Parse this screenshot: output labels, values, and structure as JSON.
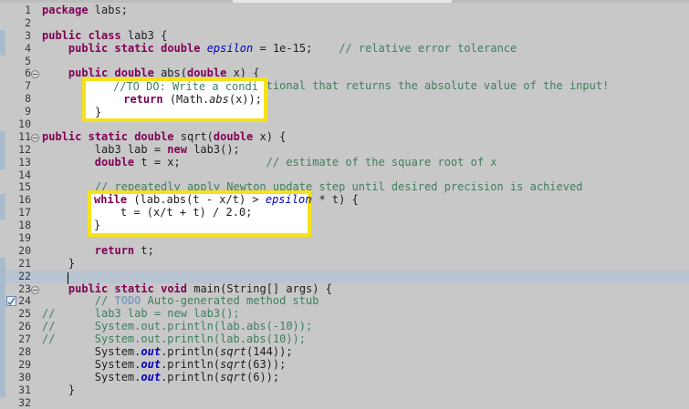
{
  "editor": {
    "lines": [
      {
        "n": "1",
        "segs": [
          {
            "t": "package",
            "c": "kw"
          },
          {
            "t": " labs;"
          }
        ]
      },
      {
        "n": "2",
        "segs": []
      },
      {
        "n": "3",
        "segs": [
          {
            "t": "public",
            "c": "kw"
          },
          {
            "t": " "
          },
          {
            "t": "class",
            "c": "kw"
          },
          {
            "t": " lab3 {"
          }
        ]
      },
      {
        "n": "4",
        "segs": [
          {
            "t": "    "
          },
          {
            "t": "public",
            "c": "kw"
          },
          {
            "t": " "
          },
          {
            "t": "static",
            "c": "kw"
          },
          {
            "t": " "
          },
          {
            "t": "double",
            "c": "kw"
          },
          {
            "t": " "
          },
          {
            "t": "epsilon",
            "c": "fld"
          },
          {
            "t": " = 1e-15;    "
          },
          {
            "t": "// relative error tolerance",
            "c": "cm"
          }
        ]
      },
      {
        "n": "5",
        "segs": []
      },
      {
        "n": "6",
        "fold": true,
        "segs": [
          {
            "t": "    "
          },
          {
            "t": "public",
            "c": "kw"
          },
          {
            "t": " "
          },
          {
            "t": "double",
            "c": "kw"
          },
          {
            "t": " abs("
          },
          {
            "t": "double",
            "c": "kw"
          },
          {
            "t": " x) {"
          }
        ]
      },
      {
        "n": "7",
        "segs": [
          {
            "t": "            "
          },
          {
            "t": "//TO DO: Write a conditional that returns the absolute value of the input!",
            "c": "cm"
          }
        ]
      },
      {
        "n": "8",
        "segs": [
          {
            "t": "            "
          },
          {
            "t": "return",
            "c": "kw"
          },
          {
            "t": " (Math."
          },
          {
            "t": "abs",
            "c": "smeth"
          },
          {
            "t": "(x));"
          }
        ]
      },
      {
        "n": "9",
        "segs": [
          {
            "t": "        }"
          }
        ]
      },
      {
        "n": "10",
        "segs": []
      },
      {
        "n": "11",
        "fold": true,
        "segs": [
          {
            "t": "public",
            "c": "kw"
          },
          {
            "t": " "
          },
          {
            "t": "static",
            "c": "kw"
          },
          {
            "t": " "
          },
          {
            "t": "double",
            "c": "kw"
          },
          {
            "t": " sqrt("
          },
          {
            "t": "double",
            "c": "kw"
          },
          {
            "t": " x) {"
          }
        ]
      },
      {
        "n": "12",
        "segs": [
          {
            "t": "        lab3 lab = "
          },
          {
            "t": "new",
            "c": "kw"
          },
          {
            "t": " lab3();"
          }
        ]
      },
      {
        "n": "13",
        "segs": [
          {
            "t": "        "
          },
          {
            "t": "double",
            "c": "kw"
          },
          {
            "t": " t = x;             "
          },
          {
            "t": "// estimate of the square root of x",
            "c": "cm"
          }
        ]
      },
      {
        "n": "14",
        "segs": []
      },
      {
        "n": "15",
        "segs": [
          {
            "t": "        "
          },
          {
            "t": "// repeatedly apply Newton update step until desired precision is achieved",
            "c": "cm"
          }
        ]
      },
      {
        "n": "16",
        "segs": [
          {
            "t": "        "
          },
          {
            "t": "while",
            "c": "kw"
          },
          {
            "t": " (lab.abs(t - x/t) > "
          },
          {
            "t": "epsilon",
            "c": "fld"
          },
          {
            "t": " * t) {"
          }
        ]
      },
      {
        "n": "17",
        "segs": [
          {
            "t": "            t = (x/t + t) / 2.0;"
          }
        ]
      },
      {
        "n": "18",
        "segs": [
          {
            "t": "        }"
          }
        ]
      },
      {
        "n": "19",
        "segs": []
      },
      {
        "n": "20",
        "segs": [
          {
            "t": "        "
          },
          {
            "t": "return",
            "c": "kw"
          },
          {
            "t": " t;"
          }
        ]
      },
      {
        "n": "21",
        "segs": [
          {
            "t": "    }"
          }
        ]
      },
      {
        "n": "22",
        "current": true,
        "segs": []
      },
      {
        "n": "23",
        "fold": true,
        "segs": [
          {
            "t": "    "
          },
          {
            "t": "public",
            "c": "kw"
          },
          {
            "t": " "
          },
          {
            "t": "static",
            "c": "kw"
          },
          {
            "t": " "
          },
          {
            "t": "void",
            "c": "kw"
          },
          {
            "t": " main(String[] args) {"
          }
        ]
      },
      {
        "n": "24",
        "warn": true,
        "segs": [
          {
            "t": "        "
          },
          {
            "t": "// ",
            "c": "cm"
          },
          {
            "t": "TODO",
            "c": "todo"
          },
          {
            "t": " Auto-generated method stub",
            "c": "cm"
          }
        ]
      },
      {
        "n": "25",
        "segs": [
          {
            "t": "//",
            "c": "cm"
          },
          {
            "t": "      lab3 lab = new lab3();",
            "c": "cm"
          }
        ]
      },
      {
        "n": "26",
        "segs": [
          {
            "t": "//",
            "c": "cm"
          },
          {
            "t": "      System.out.println(lab.abs(-10));",
            "c": "cm"
          }
        ]
      },
      {
        "n": "27",
        "segs": [
          {
            "t": "//",
            "c": "cm"
          },
          {
            "t": "      System.out.println(lab.abs(10));",
            "c": "cm"
          }
        ]
      },
      {
        "n": "28",
        "segs": [
          {
            "t": "        System."
          },
          {
            "t": "out",
            "c": "sfld"
          },
          {
            "t": ".println("
          },
          {
            "t": "sqrt",
            "c": "smeth"
          },
          {
            "t": "(144));"
          }
        ]
      },
      {
        "n": "29",
        "segs": [
          {
            "t": "        System."
          },
          {
            "t": "out",
            "c": "sfld"
          },
          {
            "t": ".println("
          },
          {
            "t": "sqrt",
            "c": "smeth"
          },
          {
            "t": "(63));"
          }
        ]
      },
      {
        "n": "30",
        "segs": [
          {
            "t": "        System."
          },
          {
            "t": "out",
            "c": "sfld"
          },
          {
            "t": ".println("
          },
          {
            "t": "sqrt",
            "c": "smeth"
          },
          {
            "t": "(6));"
          }
        ]
      },
      {
        "n": "31",
        "segs": [
          {
            "t": "    }"
          }
        ]
      },
      {
        "n": "32",
        "segs": []
      }
    ],
    "marked_lines": [
      "3",
      "4",
      "11",
      "12",
      "13",
      "16",
      "17",
      "21",
      "22",
      "23",
      "24",
      "25",
      "26",
      "27",
      "28",
      "29",
      "30",
      "31"
    ]
  },
  "highlights": [
    {
      "name": "highlight-box-abs-body",
      "lines": [
        {
          "segs": [
            {
              "t": "//TO DO: Write a condi",
              "c": "cm"
            }
          ]
        },
        {
          "segs": [
            {
              "t": " "
            },
            {
              "t": "return",
              "c": "kw"
            },
            {
              "t": " (Math."
            },
            {
              "t": "abs",
              "c": "smeth"
            },
            {
              "t": "(x));"
            }
          ]
        },
        {
          "segs": [
            {
              "t": "}"
            }
          ]
        }
      ]
    },
    {
      "name": "highlight-box-while-loop",
      "lines": [
        {
          "segs": [
            {
              "t": "while",
              "c": "kw"
            },
            {
              "t": " (lab.abs(t - x/t) > "
            },
            {
              "t": "epsilon",
              "c": "fld"
            }
          ]
        },
        {
          "segs": [
            {
              "t": "    t = (x/t + t) / 2.0;"
            }
          ]
        },
        {
          "segs": [
            {
              "t": "}"
            }
          ]
        }
      ]
    }
  ],
  "colors": {
    "keyword": "#7f0055",
    "comment": "#3f7f5f",
    "field": "#0000c0",
    "highlight_border": "#f5e21c",
    "background": "#c8c8c8"
  }
}
